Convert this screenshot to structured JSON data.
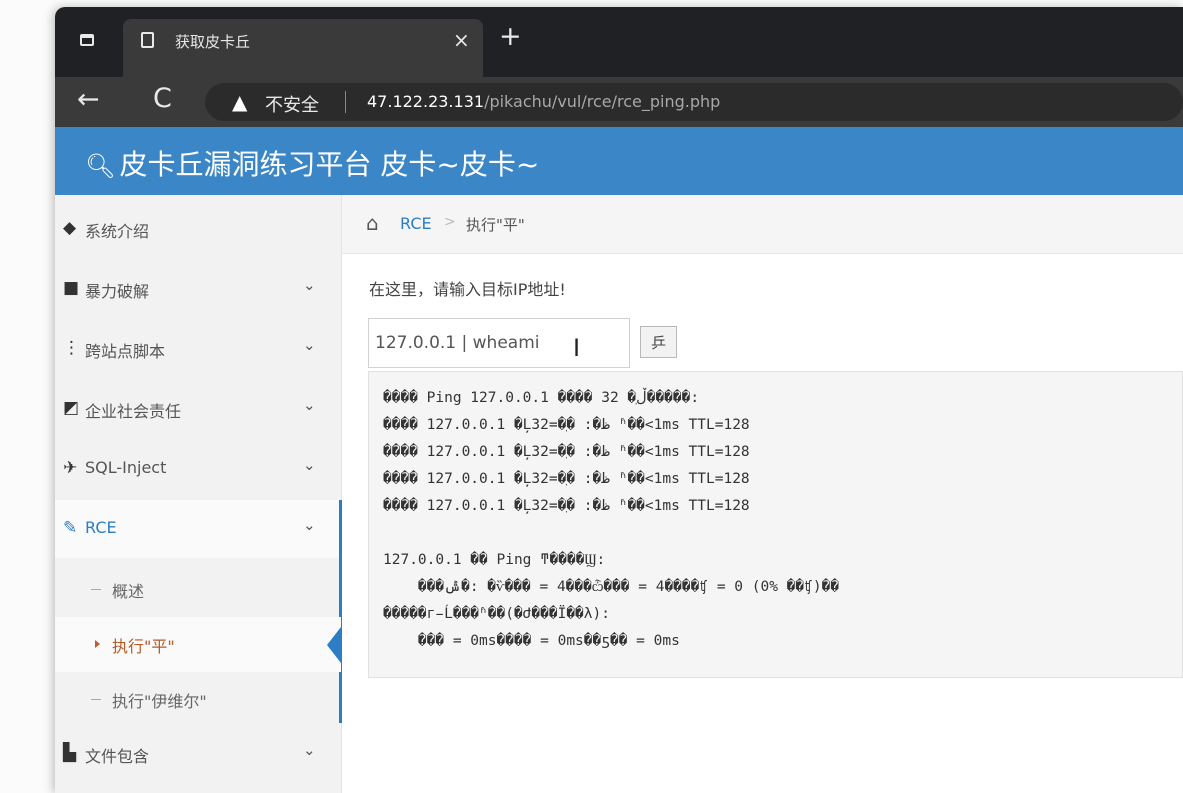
{
  "browser": {
    "tab_title": "获取皮卡丘",
    "tab_close": "×",
    "new_tab": "+",
    "back": "←",
    "reload": "C",
    "security_label": "不安全",
    "url_host": "47.122.23.131",
    "url_path": "/pikachu/vul/rce/rce_ping.php"
  },
  "site": {
    "title": "皮卡丘漏洞练习平台 皮卡~皮卡~"
  },
  "sidebar": {
    "items": [
      {
        "label": "系统介绍",
        "icon": "tag-icon",
        "has_chevron": false
      },
      {
        "label": "暴力破解",
        "icon": "lock-icon",
        "has_chevron": true
      },
      {
        "label": "跨站点脚本",
        "icon": "list-icon",
        "has_chevron": true
      },
      {
        "label": "企业社会责任",
        "icon": "external-link-icon",
        "has_chevron": true
      },
      {
        "label": "SQL-Inject",
        "icon": "plane-icon",
        "has_chevron": true
      },
      {
        "label": "RCE",
        "icon": "pencil-icon",
        "has_chevron": true,
        "active": true
      },
      {
        "label": "文件包含",
        "icon": "file-icon",
        "has_chevron": true
      }
    ],
    "rce_subitems": [
      {
        "label": "概述"
      },
      {
        "label": "执行\"平\"",
        "active": true
      },
      {
        "label": "执行\"伊维尔\""
      }
    ]
  },
  "breadcrumb": {
    "section": "RCE",
    "separator": ">",
    "current": "执行\"平\""
  },
  "form": {
    "instruction": "在这里，请输入目标IP地址!",
    "input_value": "127.0.0.1 | wheami",
    "submit_label": "乒"
  },
  "output_lines": [
    "���� Ping 127.0.0.1 ���� 32 �ֽڵ�����:",
    "���� 127.0.0.1 �Ļظ�: �ֽ�=32 ʱ��<1ms TTL=128",
    "���� 127.0.0.1 �Ļظ�: �ֽ�=32 ʱ��<1ms TTL=128",
    "���� 127.0.0.1 �Ļظ�: �ֽ�=32 ʱ��<1ms TTL=128",
    "���� 127.0.0.1 �Ļظ�: �ֽ�=32 ʱ��<1ms TTL=128",
    "",
    "127.0.0.1 �� Ping ͳ����Ϣ:",
    "    ���ݰ�: �ѷ��� = 4���ѽ��� = 4����ʧ = 0 (0% ��ʧ)��",
    "�����г̵Ĺ���ʱ��(�Ժ���Ϊ��λ):",
    "    ��� = 0ms���� = 0ms��ƽ�� = 0ms"
  ],
  "colors": {
    "header_blue": "#3a86c7",
    "link_blue": "#2c7dc4",
    "browser_dark": "#202124"
  }
}
